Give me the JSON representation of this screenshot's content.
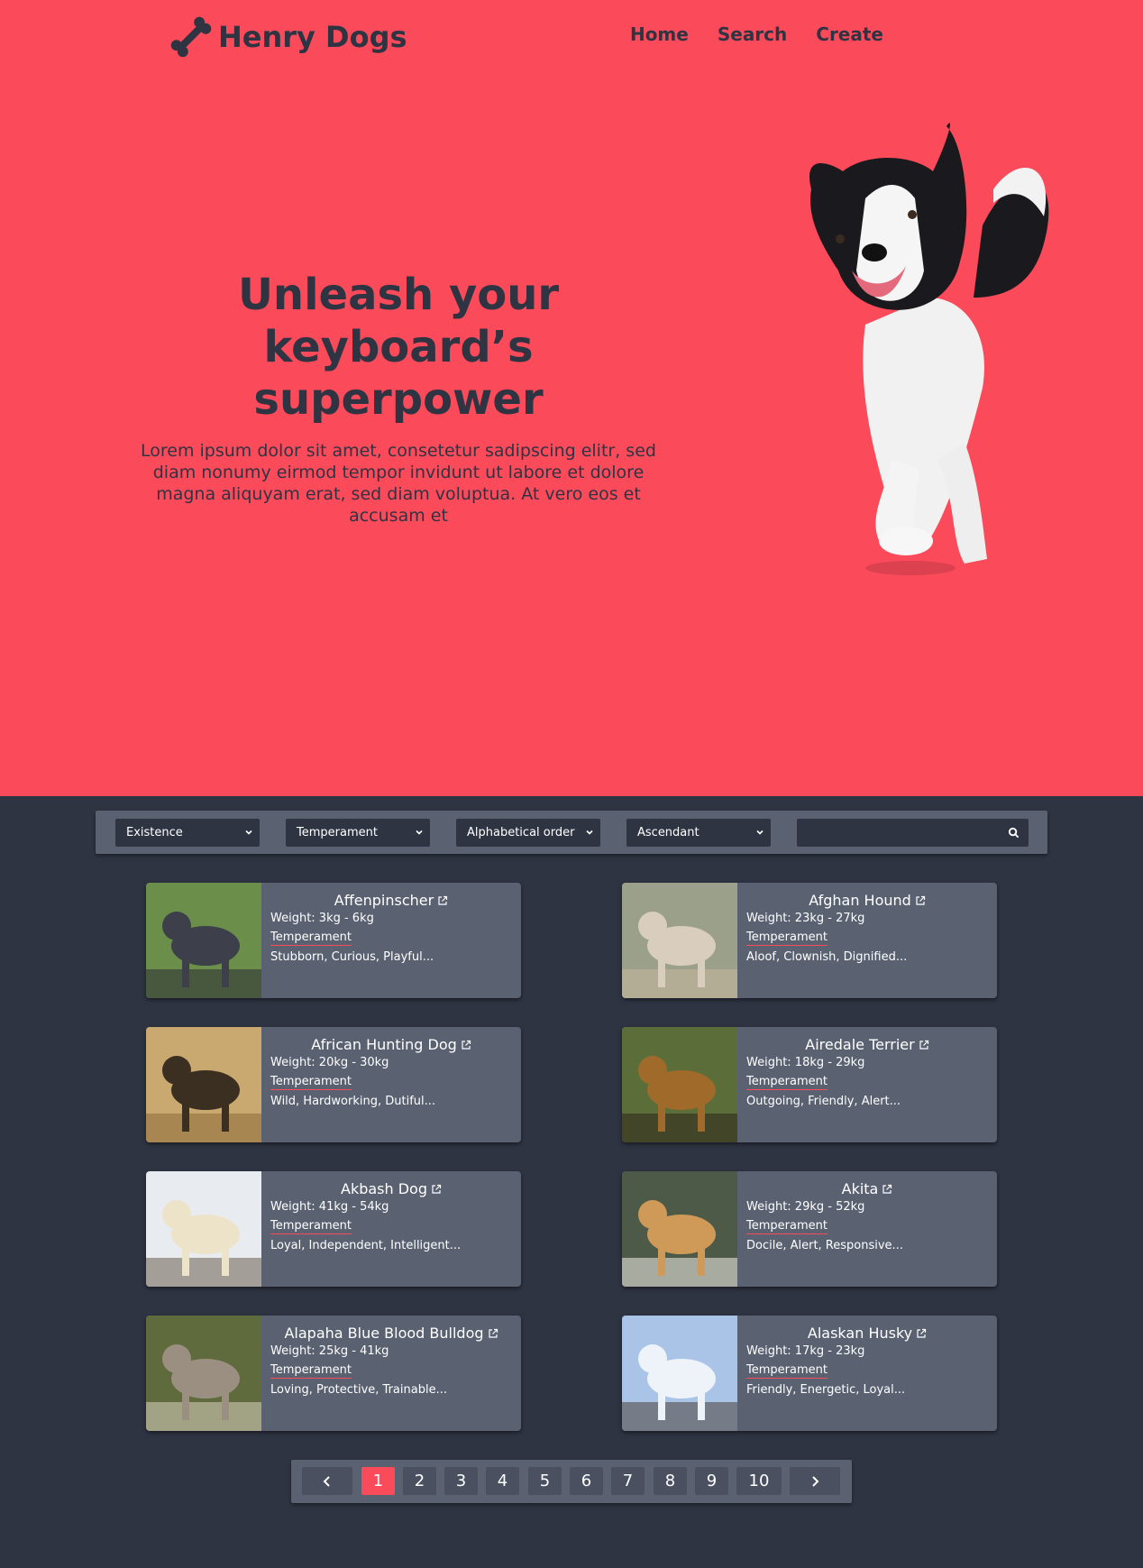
{
  "header": {
    "logo_text": "Henry Dogs",
    "nav": [
      "Home",
      "Search",
      "Create"
    ]
  },
  "hero": {
    "title_lines": [
      "Unleash your",
      "keyboard’s",
      "superpower"
    ],
    "text": "Lorem ipsum dolor sit amet, consetetur sadipscing elitr, sed diam nonumy eirmod tempor invidunt ut labore et dolore magna aliquyam erat, sed diam voluptua. At vero eos et accusam et"
  },
  "filters": {
    "existence": "Existence",
    "temperament": "Temperament",
    "order": "Alphabetical order",
    "direction": "Ascendant",
    "search_placeholder": ""
  },
  "card_labels": {
    "temperament": "Temperament"
  },
  "dogs": [
    {
      "name": "Affenpinscher",
      "weight": "Weight: 3kg - 6kg",
      "temperament": "Stubborn, Curious, Playful..."
    },
    {
      "name": "Afghan Hound",
      "weight": "Weight: 23kg - 27kg",
      "temperament": "Aloof, Clownish, Dignified..."
    },
    {
      "name": "African Hunting Dog",
      "weight": "Weight: 20kg - 30kg",
      "temperament": "Wild, Hardworking, Dutiful..."
    },
    {
      "name": "Airedale Terrier",
      "weight": "Weight: 18kg - 29kg",
      "temperament": "Outgoing, Friendly, Alert..."
    },
    {
      "name": "Akbash Dog",
      "weight": "Weight: 41kg - 54kg",
      "temperament": "Loyal, Independent, Intelligent..."
    },
    {
      "name": "Akita",
      "weight": "Weight: 29kg - 52kg",
      "temperament": "Docile, Alert, Responsive..."
    },
    {
      "name": "Alapaha Blue Blood Bulldog",
      "weight": "Weight: 25kg - 41kg",
      "temperament": "Loving, Protective, Trainable..."
    },
    {
      "name": "Alaskan Husky",
      "weight": "Weight: 17kg - 23kg",
      "temperament": "Friendly, Energetic, Loyal..."
    }
  ],
  "pagination": {
    "pages": [
      "1",
      "2",
      "3",
      "4",
      "5",
      "6",
      "7",
      "8",
      "9",
      "10"
    ],
    "current": "1"
  },
  "colors": {
    "brand": "#fb4a5a",
    "dark": "#2f3443",
    "panel": "#5a6171"
  }
}
